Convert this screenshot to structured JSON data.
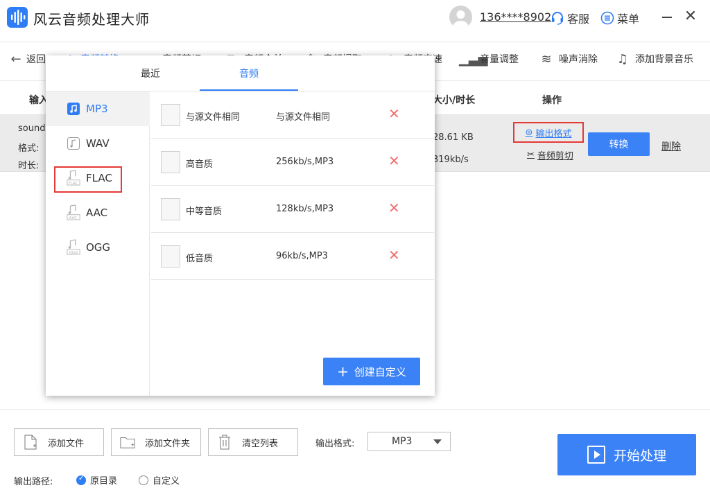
{
  "app": {
    "title": "风云音频处理大师",
    "brand_color": "#2f7df6"
  },
  "account": {
    "phone": "136****8902",
    "service_label": "客服",
    "menu_label": "菜单"
  },
  "toolbar": {
    "back_label": "返回",
    "items": [
      {
        "label": "音频转换",
        "icon": "convert-icon"
      },
      {
        "label": "音频剪切",
        "icon": "cut-icon"
      },
      {
        "label": "音频合并",
        "icon": "merge-icon"
      },
      {
        "label": "音频提取",
        "icon": "extract-icon"
      },
      {
        "label": "音频变速",
        "icon": "speed-icon"
      },
      {
        "label": "音量调整",
        "icon": "volume-icon"
      },
      {
        "label": "噪声消除",
        "icon": "noise-icon"
      },
      {
        "label": "添加背景音乐",
        "icon": "music-icon"
      }
    ]
  },
  "list": {
    "headers": {
      "input": "输入",
      "size": "大小/时长",
      "action": "操作"
    },
    "file": {
      "name": "sound",
      "format_label": "格式:",
      "duration_label": "时长:",
      "size": "28.61 KB",
      "bitrate": "319kb/s",
      "output_format_link": "输出格式",
      "cut_link": "音频剪切",
      "convert_label": "转换",
      "delete_label": "删除"
    }
  },
  "popup": {
    "tabs": [
      {
        "label": "最近"
      },
      {
        "label": "音频"
      }
    ],
    "formats": [
      "MP3",
      "WAV",
      "FLAC",
      "AAC",
      "OGG"
    ],
    "presets": [
      {
        "name": "与源文件相同",
        "desc": "与源文件相同"
      },
      {
        "name": "高音质",
        "desc": "256kb/s,MP3"
      },
      {
        "name": "中等音质",
        "desc": "128kb/s,MP3"
      },
      {
        "name": "低音质",
        "desc": "96kb/s,MP3"
      }
    ],
    "create_label": "创建自定义"
  },
  "bottom": {
    "add_file": "添加文件",
    "add_folder": "添加文件夹",
    "clear_list": "清空列表",
    "output_format_label": "输出格式:",
    "output_format_value": "MP3",
    "start_label": "开始处理",
    "output_path_label": "输出路径:",
    "radio_original": "原目录",
    "radio_custom": "自定义"
  }
}
